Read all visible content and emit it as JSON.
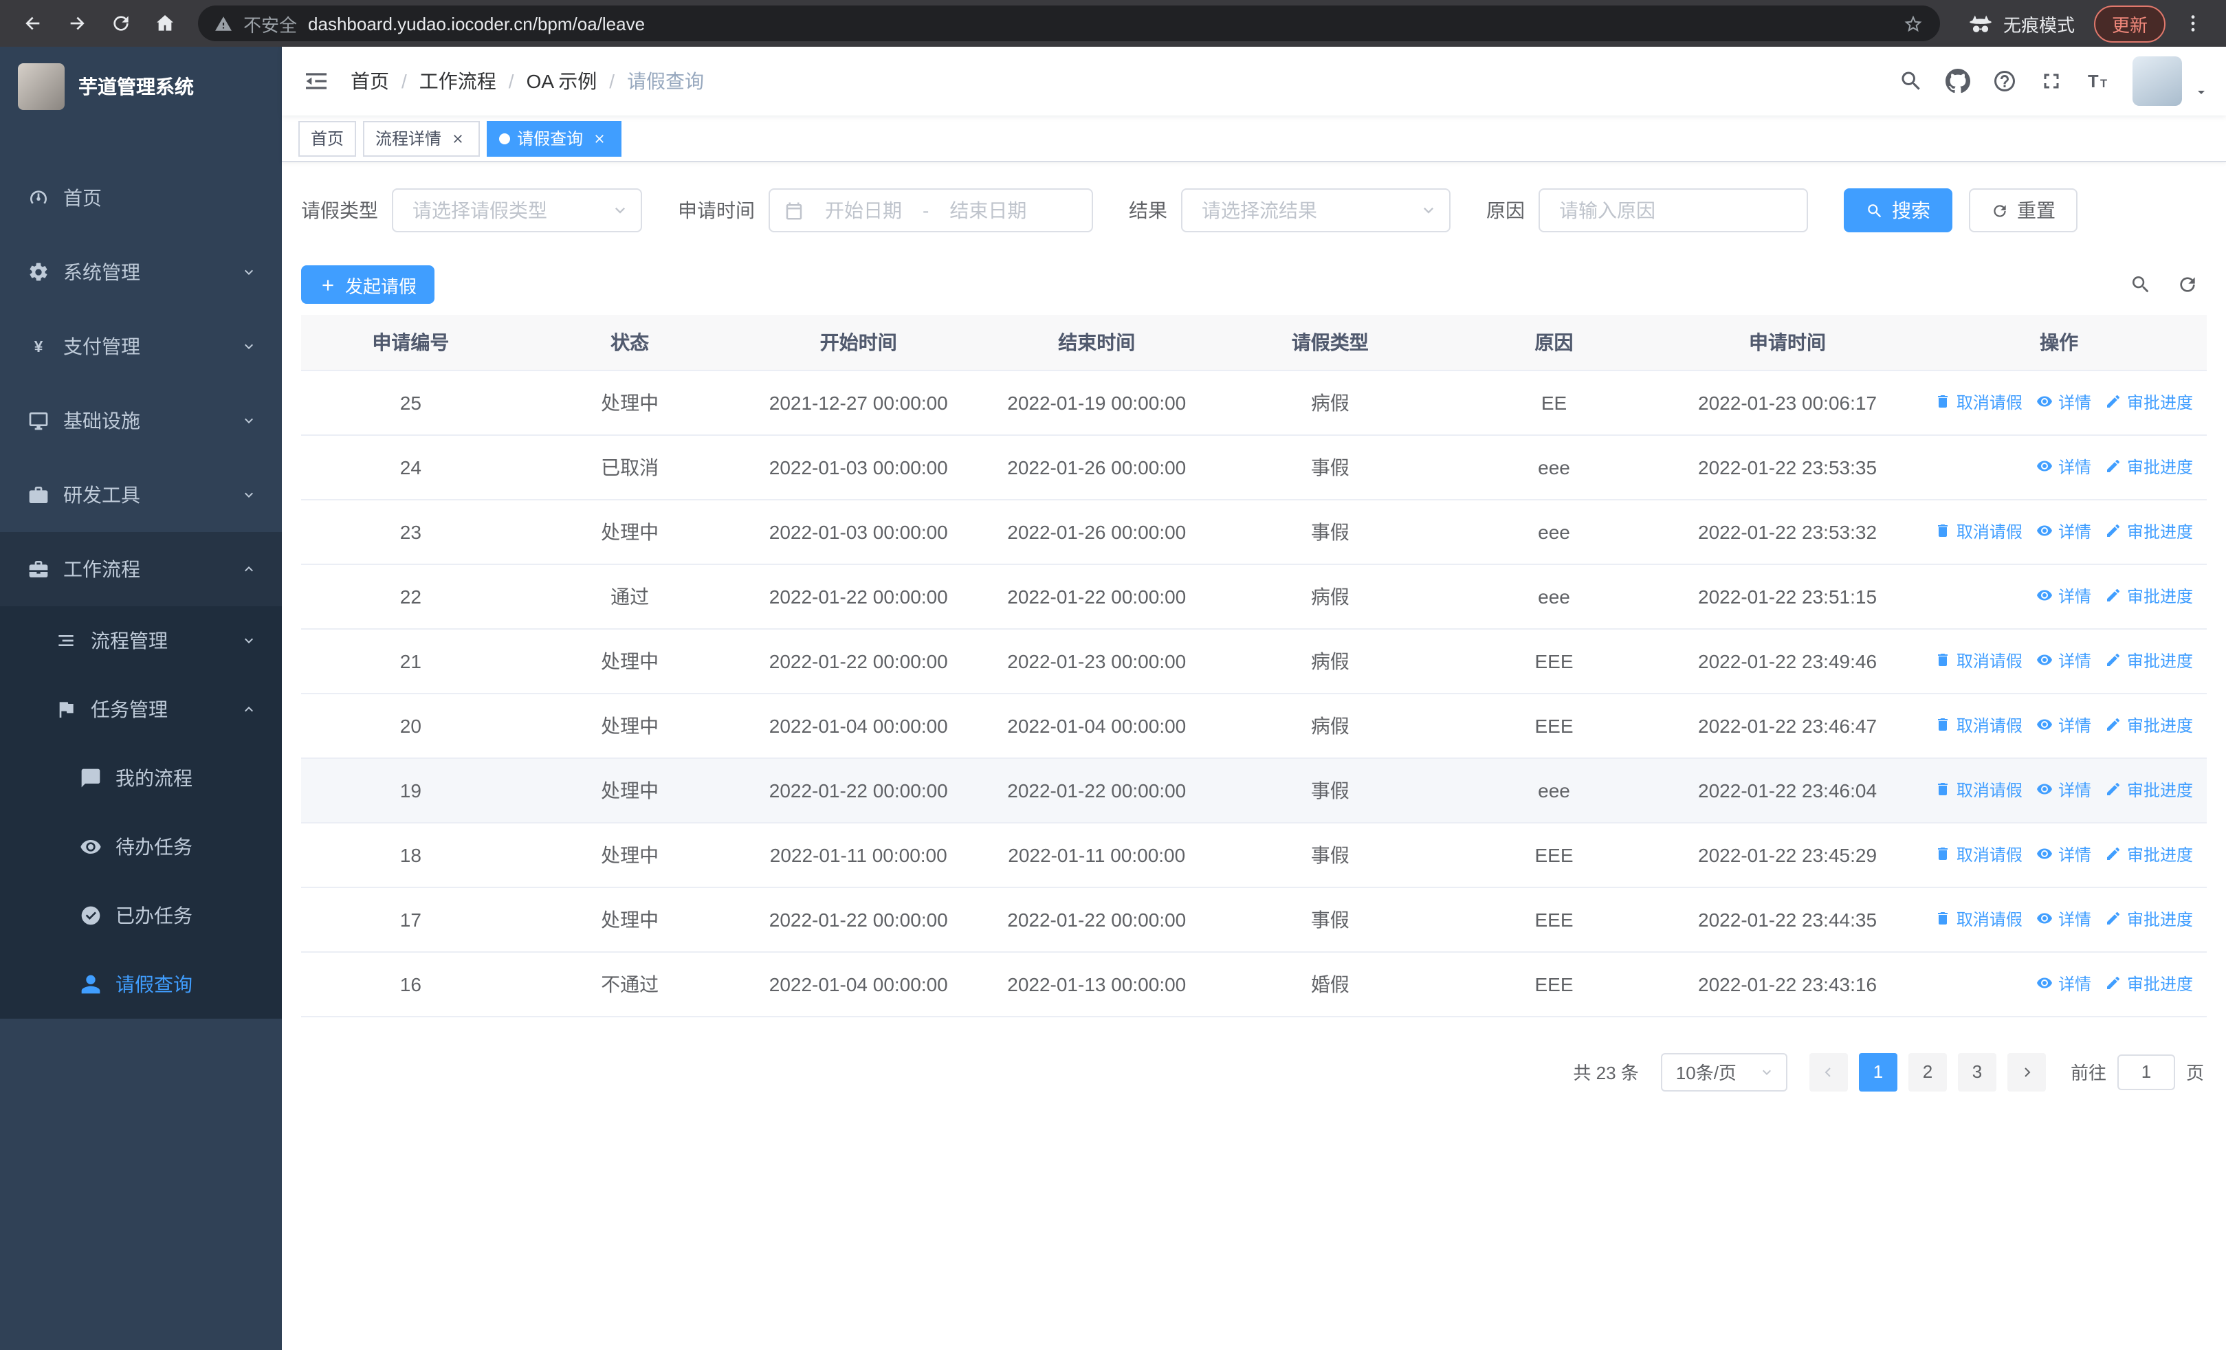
{
  "browser": {
    "security_label": "不安全",
    "url": "dashboard.yudao.iocoder.cn/bpm/oa/leave",
    "incognito_label": "无痕模式",
    "update_label": "更新"
  },
  "sidebar": {
    "logo_title": "芋道管理系统",
    "items": [
      {
        "key": "home",
        "label": "首页",
        "icon": "dashboard-icon",
        "level": 1
      },
      {
        "key": "system",
        "label": "系统管理",
        "icon": "gear-icon",
        "level": 1,
        "arrow": "down"
      },
      {
        "key": "payment",
        "label": "支付管理",
        "icon": "yen-icon",
        "level": 1,
        "arrow": "down"
      },
      {
        "key": "infrastructure",
        "label": "基础设施",
        "icon": "monitor-icon",
        "level": 1,
        "arrow": "down"
      },
      {
        "key": "devtools",
        "label": "研发工具",
        "icon": "toolbox-icon",
        "level": 1,
        "arrow": "down"
      },
      {
        "key": "workflow",
        "label": "工作流程",
        "icon": "briefcase-icon",
        "level": 1,
        "arrow": "up",
        "expanded": true
      },
      {
        "key": "process-mgmt",
        "label": "流程管理",
        "icon": "stream-icon",
        "level": 2,
        "arrow": "down"
      },
      {
        "key": "task-mgmt",
        "label": "任务管理",
        "icon": "flag-icon",
        "level": 2,
        "arrow": "up",
        "expanded": true
      },
      {
        "key": "my-process",
        "label": "我的流程",
        "icon": "chat-icon",
        "level": 3
      },
      {
        "key": "todo-tasks",
        "label": "待办任务",
        "icon": "eye-icon",
        "level": 3
      },
      {
        "key": "done-tasks",
        "label": "已办任务",
        "icon": "check-circle-icon",
        "level": 3
      },
      {
        "key": "leave-query",
        "label": "请假查询",
        "icon": "user-icon",
        "level": 3,
        "active": true
      }
    ]
  },
  "header": {
    "breadcrumb": [
      "首页",
      "工作流程",
      "OA 示例",
      "请假查询"
    ],
    "separator": "/"
  },
  "tabs": [
    {
      "label": "首页",
      "closable": false,
      "active": false
    },
    {
      "label": "流程详情",
      "closable": true,
      "active": false
    },
    {
      "label": "请假查询",
      "closable": true,
      "active": true
    }
  ],
  "filters": {
    "leave_type_label": "请假类型",
    "leave_type_placeholder": "请选择请假类型",
    "apply_time_label": "申请时间",
    "date_start_placeholder": "开始日期",
    "date_separator": "-",
    "date_end_placeholder": "结束日期",
    "result_label": "结果",
    "result_placeholder": "请选择流结果",
    "reason_label": "原因",
    "reason_placeholder": "请输入原因",
    "search_label": "搜索",
    "reset_label": "重置"
  },
  "toolbar": {
    "create_label": "发起请假"
  },
  "table": {
    "columns": [
      "申请编号",
      "状态",
      "开始时间",
      "结束时间",
      "请假类型",
      "原因",
      "申请时间",
      "操作"
    ],
    "action_labels": {
      "cancel": "取消请假",
      "detail": "详情",
      "progress": "审批进度"
    },
    "rows": [
      {
        "id": "25",
        "status": "处理中",
        "start": "2021-12-27 00:00:00",
        "end": "2022-01-19 00:00:00",
        "type": "病假",
        "reason": "EE",
        "apply_time": "2022-01-23 00:06:17",
        "actions": [
          "cancel",
          "detail",
          "progress"
        ]
      },
      {
        "id": "24",
        "status": "已取消",
        "start": "2022-01-03 00:00:00",
        "end": "2022-01-26 00:00:00",
        "type": "事假",
        "reason": "eee",
        "apply_time": "2022-01-22 23:53:35",
        "actions": [
          "detail",
          "progress"
        ]
      },
      {
        "id": "23",
        "status": "处理中",
        "start": "2022-01-03 00:00:00",
        "end": "2022-01-26 00:00:00",
        "type": "事假",
        "reason": "eee",
        "apply_time": "2022-01-22 23:53:32",
        "actions": [
          "cancel",
          "detail",
          "progress"
        ]
      },
      {
        "id": "22",
        "status": "通过",
        "start": "2022-01-22 00:00:00",
        "end": "2022-01-22 00:00:00",
        "type": "病假",
        "reason": "eee",
        "apply_time": "2022-01-22 23:51:15",
        "actions": [
          "detail",
          "progress"
        ]
      },
      {
        "id": "21",
        "status": "处理中",
        "start": "2022-01-22 00:00:00",
        "end": "2022-01-23 00:00:00",
        "type": "病假",
        "reason": "EEE",
        "apply_time": "2022-01-22 23:49:46",
        "actions": [
          "cancel",
          "detail",
          "progress"
        ]
      },
      {
        "id": "20",
        "status": "处理中",
        "start": "2022-01-04 00:00:00",
        "end": "2022-01-04 00:00:00",
        "type": "病假",
        "reason": "EEE",
        "apply_time": "2022-01-22 23:46:47",
        "actions": [
          "cancel",
          "detail",
          "progress"
        ]
      },
      {
        "id": "19",
        "status": "处理中",
        "start": "2022-01-22 00:00:00",
        "end": "2022-01-22 00:00:00",
        "type": "事假",
        "reason": "eee",
        "apply_time": "2022-01-22 23:46:04",
        "actions": [
          "cancel",
          "detail",
          "progress"
        ],
        "highlight": true
      },
      {
        "id": "18",
        "status": "处理中",
        "start": "2022-01-11 00:00:00",
        "end": "2022-01-11 00:00:00",
        "type": "事假",
        "reason": "EEE",
        "apply_time": "2022-01-22 23:45:29",
        "actions": [
          "cancel",
          "detail",
          "progress"
        ]
      },
      {
        "id": "17",
        "status": "处理中",
        "start": "2022-01-22 00:00:00",
        "end": "2022-01-22 00:00:00",
        "type": "事假",
        "reason": "EEE",
        "apply_time": "2022-01-22 23:44:35",
        "actions": [
          "cancel",
          "detail",
          "progress"
        ]
      },
      {
        "id": "16",
        "status": "不通过",
        "start": "2022-01-04 00:00:00",
        "end": "2022-01-13 00:00:00",
        "type": "婚假",
        "reason": "EEE",
        "apply_time": "2022-01-22 23:43:16",
        "actions": [
          "detail",
          "progress"
        ]
      }
    ]
  },
  "pagination": {
    "total_label": "共 23 条",
    "page_size_label": "10条/页",
    "pages": [
      "1",
      "2",
      "3"
    ],
    "active_page": "1",
    "goto_label": "前往",
    "goto_value": "1",
    "goto_suffix": "页"
  },
  "colors": {
    "primary": "#409eff",
    "sidebar_bg": "#304156",
    "submenu_bg": "#1f2d3d",
    "table_header_bg": "#f8f8f9"
  }
}
